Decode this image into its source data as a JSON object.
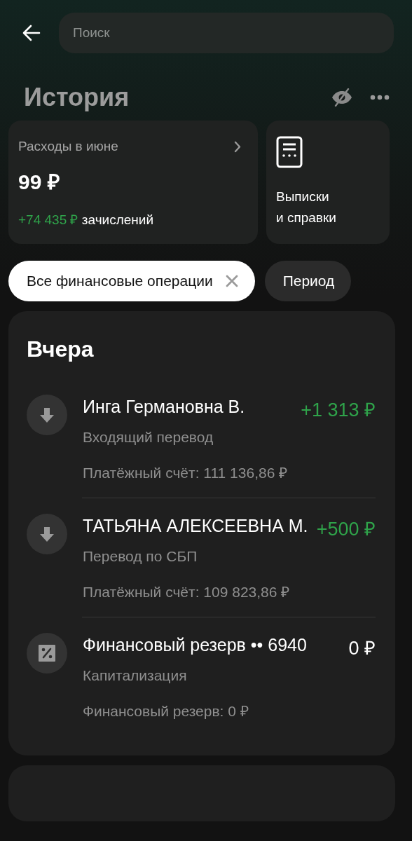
{
  "header": {
    "search": {
      "placeholder": "Поиск"
    }
  },
  "title": "История",
  "summary": {
    "label": "Расходы в июне",
    "amount": "99 ₽",
    "income": "+74 435 ₽",
    "income_label": "зачислений"
  },
  "documents": {
    "label": "Выписки\nи справки"
  },
  "filters": [
    {
      "label": "Все финансовые операции",
      "selected": true
    },
    {
      "label": "Период",
      "selected": false
    }
  ],
  "sections": [
    {
      "title": "Вчера",
      "transactions": [
        {
          "kind": "transfer",
          "name": "Инга Германовна В.",
          "type": "Входящий перевод",
          "amount": "+1 313 ₽",
          "positive": true,
          "account": "Платёжный счёт: 111 136,86 ₽"
        },
        {
          "kind": "transfer",
          "name": "ТАТЬЯНА АЛЕКСЕЕВНА М.",
          "type": "Перевод по СБП",
          "amount": "+500 ₽",
          "positive": true,
          "account": "Платёжный счёт: 109 823,86 ₽"
        },
        {
          "kind": "interest",
          "name": "Финансовый резерв •• 6940",
          "type": "Капитализация",
          "amount": "0 ₽",
          "positive": false,
          "account": "Финансовый резерв: 0 ₽"
        }
      ]
    }
  ]
}
